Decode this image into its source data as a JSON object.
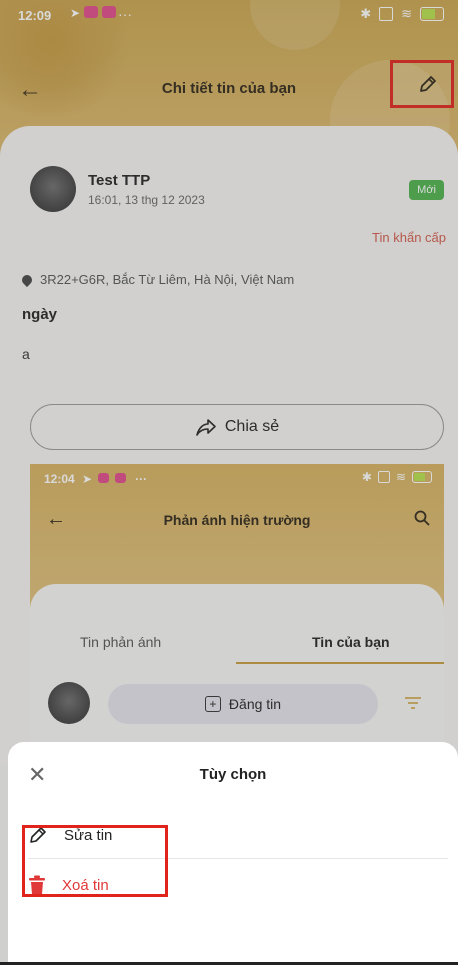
{
  "status_bar": {
    "time": "12:09",
    "dots": "···"
  },
  "app_bar": {
    "title": "Chi tiết tin của bạn"
  },
  "post": {
    "author": "Test TTP",
    "time": "16:01, 13 thg 12 2023",
    "badge": "Mới",
    "urgent_label": "Tin khẩn cấp",
    "location": "3R22+G6R, Bắc Từ Liêm, Hà Nội, Việt Nam",
    "title": "ngày",
    "body": "a",
    "share_label": "Chia sẻ"
  },
  "inner_screen": {
    "status_time": "12:04",
    "dots": "···",
    "title": "Phản ánh hiện trường",
    "tabs": [
      "Tin phản ánh",
      "Tin của bạn"
    ],
    "post_button": "Đăng tin"
  },
  "sheet": {
    "title": "Tùy chọn",
    "items": [
      {
        "label": "Sửa tin",
        "icon": "pencil-icon"
      },
      {
        "label": "Xoá tin",
        "icon": "trash-icon"
      }
    ]
  },
  "colors": {
    "accent": "#d6b262",
    "badge_green": "#4cb34c",
    "urgent_red": "#d25a4a",
    "delete_red": "#e03838",
    "highlight_red": "#e0241b"
  }
}
